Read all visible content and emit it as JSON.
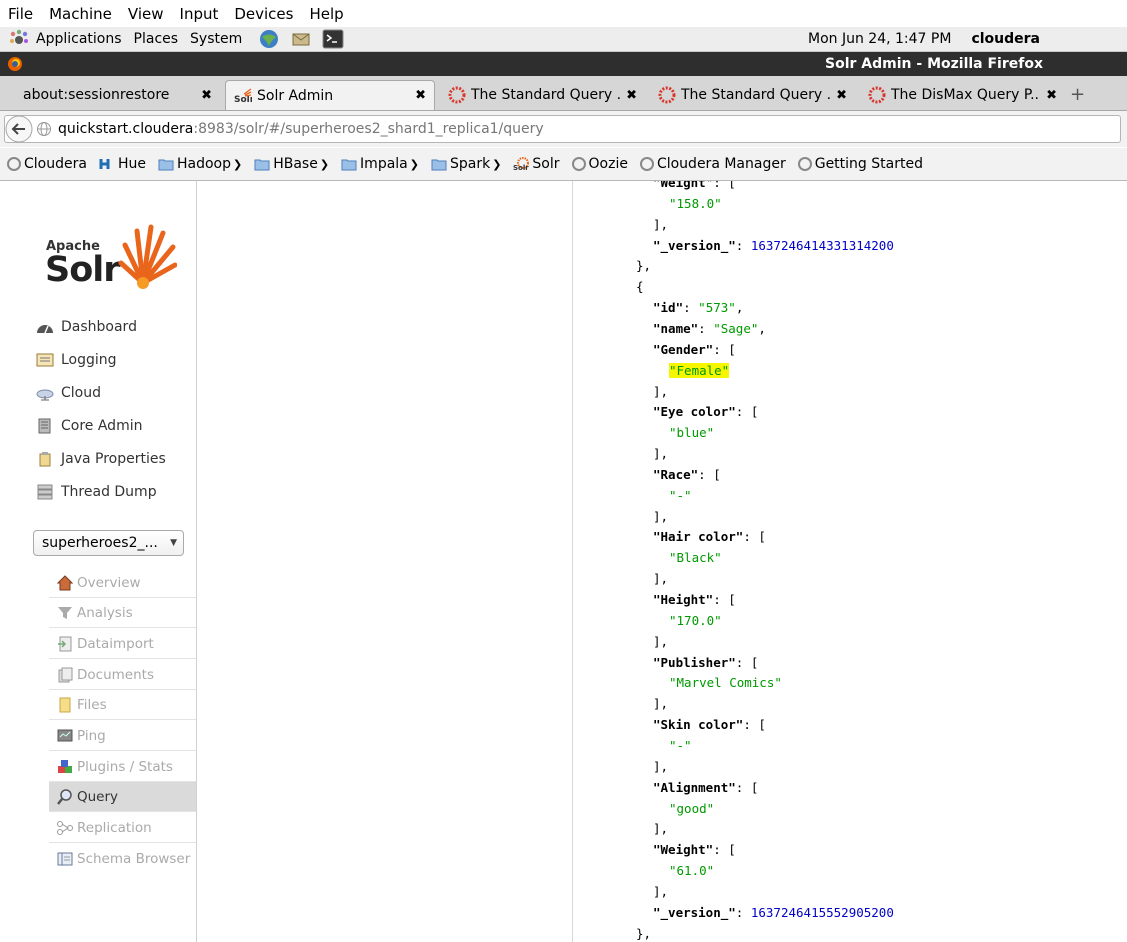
{
  "vm_menu": [
    "File",
    "Machine",
    "View",
    "Input",
    "Devices",
    "Help"
  ],
  "gnome": {
    "applications": "Applications",
    "places": "Places",
    "system": "System",
    "datetime": "Mon Jun 24,  1:47 PM",
    "user": "cloudera"
  },
  "window_title": "Solr Admin - Mozilla Firefox",
  "tabs": [
    {
      "label": "about:sessionrestore"
    },
    {
      "label": "Solr Admin"
    },
    {
      "label": "The Standard Query ..."
    },
    {
      "label": "The Standard Query ..."
    },
    {
      "label": "The DisMax Query P..."
    }
  ],
  "url": {
    "host": "quickstart.cloudera",
    "rest": ":8983/solr/#/superheroes2_shard1_replica1/query"
  },
  "bookmarks": [
    "Cloudera",
    "Hue",
    "Hadoop",
    "HBase",
    "Impala",
    "Spark",
    "Solr",
    "Oozie",
    "Cloudera Manager",
    "Getting Started"
  ],
  "logo": {
    "top": "Apache",
    "main": "Solr"
  },
  "main_menu": [
    "Dashboard",
    "Logging",
    "Cloud",
    "Core Admin",
    "Java Properties",
    "Thread Dump"
  ],
  "core_selector": "superheroes2_...",
  "core_menu": [
    "Overview",
    "Analysis",
    "Dataimport",
    "Documents",
    "Files",
    "Ping",
    "Plugins / Stats",
    "Query",
    "Replication",
    "Schema Browser"
  ],
  "json_lines": [
    {
      "indent": "    ",
      "parts": [
        {
          "t": "\"",
          "c": "k"
        },
        {
          "t": "Weight",
          "c": "k"
        },
        {
          "t": "\": [",
          "c": ""
        }
      ]
    },
    {
      "indent": "      ",
      "parts": [
        {
          "t": "\"158.0\"",
          "c": "s"
        }
      ]
    },
    {
      "indent": "    ",
      "parts": [
        {
          "t": "],",
          "c": ""
        }
      ]
    },
    {
      "indent": "    ",
      "parts": [
        {
          "t": "\"_version_\"",
          "c": "k"
        },
        {
          "t": ": ",
          "c": ""
        },
        {
          "t": "1637246414331314200",
          "c": "n"
        }
      ]
    },
    {
      "indent": "  ",
      "parts": [
        {
          "t": "},",
          "c": ""
        }
      ]
    },
    {
      "indent": "  ",
      "parts": [
        {
          "t": "{",
          "c": ""
        }
      ]
    },
    {
      "indent": "    ",
      "parts": [
        {
          "t": "\"id\"",
          "c": "k"
        },
        {
          "t": ": ",
          "c": ""
        },
        {
          "t": "\"573\"",
          "c": "s"
        },
        {
          "t": ",",
          "c": ""
        }
      ]
    },
    {
      "indent": "    ",
      "parts": [
        {
          "t": "\"name\"",
          "c": "k"
        },
        {
          "t": ": ",
          "c": ""
        },
        {
          "t": "\"Sage\"",
          "c": "s"
        },
        {
          "t": ",",
          "c": ""
        }
      ]
    },
    {
      "indent": "    ",
      "parts": [
        {
          "t": "\"Gender\"",
          "c": "k"
        },
        {
          "t": ": [",
          "c": ""
        }
      ]
    },
    {
      "indent": "      ",
      "parts": [
        {
          "t": "\"Female\"",
          "c": "s hl"
        }
      ]
    },
    {
      "indent": "    ",
      "parts": [
        {
          "t": "],",
          "c": ""
        }
      ]
    },
    {
      "indent": "    ",
      "parts": [
        {
          "t": "\"Eye color\"",
          "c": "k"
        },
        {
          "t": ": [",
          "c": ""
        }
      ]
    },
    {
      "indent": "      ",
      "parts": [
        {
          "t": "\"blue\"",
          "c": "s"
        }
      ]
    },
    {
      "indent": "    ",
      "parts": [
        {
          "t": "],",
          "c": ""
        }
      ]
    },
    {
      "indent": "    ",
      "parts": [
        {
          "t": "\"Race\"",
          "c": "k"
        },
        {
          "t": ": [",
          "c": ""
        }
      ]
    },
    {
      "indent": "      ",
      "parts": [
        {
          "t": "\"-\"",
          "c": "s"
        }
      ]
    },
    {
      "indent": "    ",
      "parts": [
        {
          "t": "],",
          "c": ""
        }
      ]
    },
    {
      "indent": "    ",
      "parts": [
        {
          "t": "\"Hair color\"",
          "c": "k"
        },
        {
          "t": ": [",
          "c": ""
        }
      ]
    },
    {
      "indent": "      ",
      "parts": [
        {
          "t": "\"Black\"",
          "c": "s"
        }
      ]
    },
    {
      "indent": "    ",
      "parts": [
        {
          "t": "],",
          "c": ""
        }
      ]
    },
    {
      "indent": "    ",
      "parts": [
        {
          "t": "\"Height\"",
          "c": "k"
        },
        {
          "t": ": [",
          "c": ""
        }
      ]
    },
    {
      "indent": "      ",
      "parts": [
        {
          "t": "\"170.0\"",
          "c": "s"
        }
      ]
    },
    {
      "indent": "    ",
      "parts": [
        {
          "t": "],",
          "c": ""
        }
      ]
    },
    {
      "indent": "    ",
      "parts": [
        {
          "t": "\"Publisher\"",
          "c": "k"
        },
        {
          "t": ": [",
          "c": ""
        }
      ]
    },
    {
      "indent": "      ",
      "parts": [
        {
          "t": "\"Marvel Comics\"",
          "c": "s"
        }
      ]
    },
    {
      "indent": "    ",
      "parts": [
        {
          "t": "],",
          "c": ""
        }
      ]
    },
    {
      "indent": "    ",
      "parts": [
        {
          "t": "\"Skin color\"",
          "c": "k"
        },
        {
          "t": ": [",
          "c": ""
        }
      ]
    },
    {
      "indent": "      ",
      "parts": [
        {
          "t": "\"-\"",
          "c": "s"
        }
      ]
    },
    {
      "indent": "    ",
      "parts": [
        {
          "t": "],",
          "c": ""
        }
      ]
    },
    {
      "indent": "    ",
      "parts": [
        {
          "t": "\"Alignment\"",
          "c": "k"
        },
        {
          "t": ": [",
          "c": ""
        }
      ]
    },
    {
      "indent": "      ",
      "parts": [
        {
          "t": "\"good\"",
          "c": "s"
        }
      ]
    },
    {
      "indent": "    ",
      "parts": [
        {
          "t": "],",
          "c": ""
        }
      ]
    },
    {
      "indent": "    ",
      "parts": [
        {
          "t": "\"Weight\"",
          "c": "k"
        },
        {
          "t": ": [",
          "c": ""
        }
      ]
    },
    {
      "indent": "      ",
      "parts": [
        {
          "t": "\"61.0\"",
          "c": "s"
        }
      ]
    },
    {
      "indent": "    ",
      "parts": [
        {
          "t": "],",
          "c": ""
        }
      ]
    },
    {
      "indent": "    ",
      "parts": [
        {
          "t": "\"_version_\"",
          "c": "k"
        },
        {
          "t": ": ",
          "c": ""
        },
        {
          "t": "1637246415552905200",
          "c": "n"
        }
      ]
    },
    {
      "indent": "  ",
      "parts": [
        {
          "t": "},",
          "c": ""
        }
      ]
    }
  ]
}
